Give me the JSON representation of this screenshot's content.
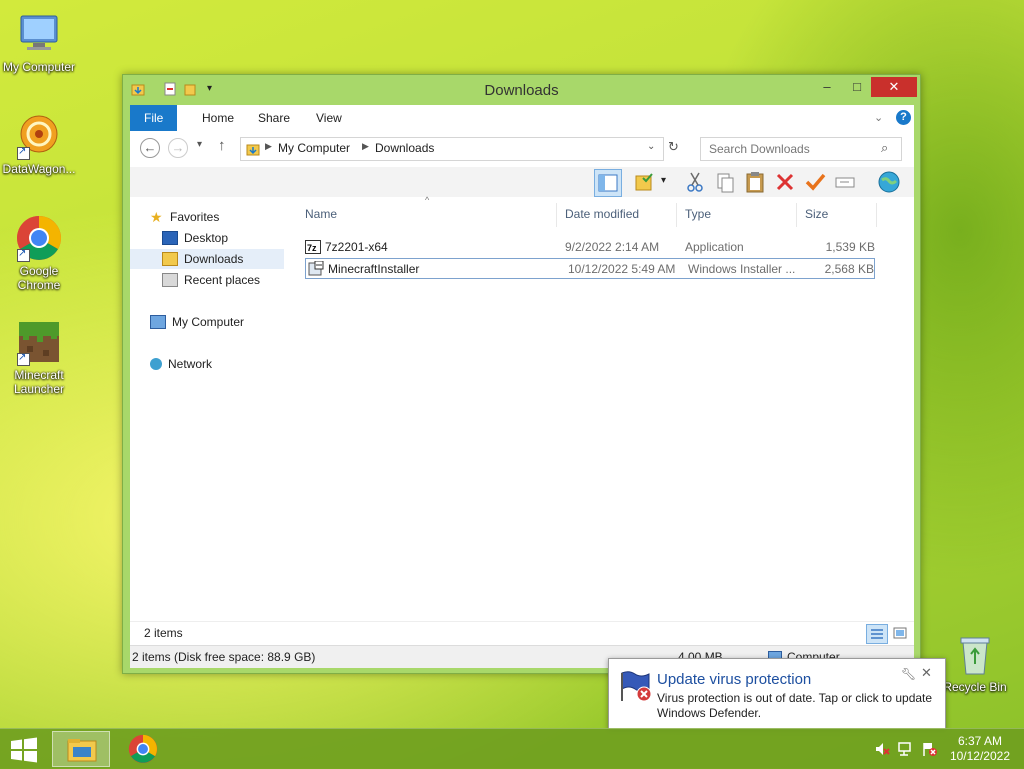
{
  "desktop": {
    "icons": [
      {
        "label": "My Computer"
      },
      {
        "label": "DataWagon..."
      },
      {
        "label": "Google Chrome"
      },
      {
        "label": "Minecraft Launcher"
      },
      {
        "label": "Recycle Bin"
      }
    ]
  },
  "window": {
    "title": "Downloads",
    "tabs": [
      "File",
      "Home",
      "Share",
      "View"
    ],
    "address": {
      "crumbs": [
        "My Computer",
        "Downloads"
      ]
    },
    "search": {
      "placeholder": "Search Downloads"
    },
    "nav": {
      "favorites": "Favorites",
      "desktop": "Desktop",
      "downloads": "Downloads",
      "recent": "Recent places",
      "my_computer": "My Computer",
      "network": "Network"
    },
    "columns": [
      "Name",
      "Date modified",
      "Type",
      "Size"
    ],
    "files": [
      {
        "name": "7z2201-x64",
        "date": "9/2/2022 2:14 AM",
        "type": "Application",
        "size": "1,539 KB"
      },
      {
        "name": "MinecraftInstaller",
        "date": "10/12/2022 5:49 AM",
        "type": "Windows Installer ...",
        "size": "2,568 KB"
      }
    ],
    "item_count": "2 items",
    "status": {
      "left": "2 items (Disk free space: 88.9 GB)",
      "size": "4.00 MB",
      "location": "Computer"
    }
  },
  "notification": {
    "title": "Update virus protection",
    "body": "Virus protection is out of date. Tap or click to update Windows Defender."
  },
  "taskbar": {
    "time": "6:37 AM",
    "date": "10/12/2022"
  },
  "colors": {
    "accent": "#1979ca",
    "selection": "#cce8ff",
    "close": "#c9302c"
  }
}
